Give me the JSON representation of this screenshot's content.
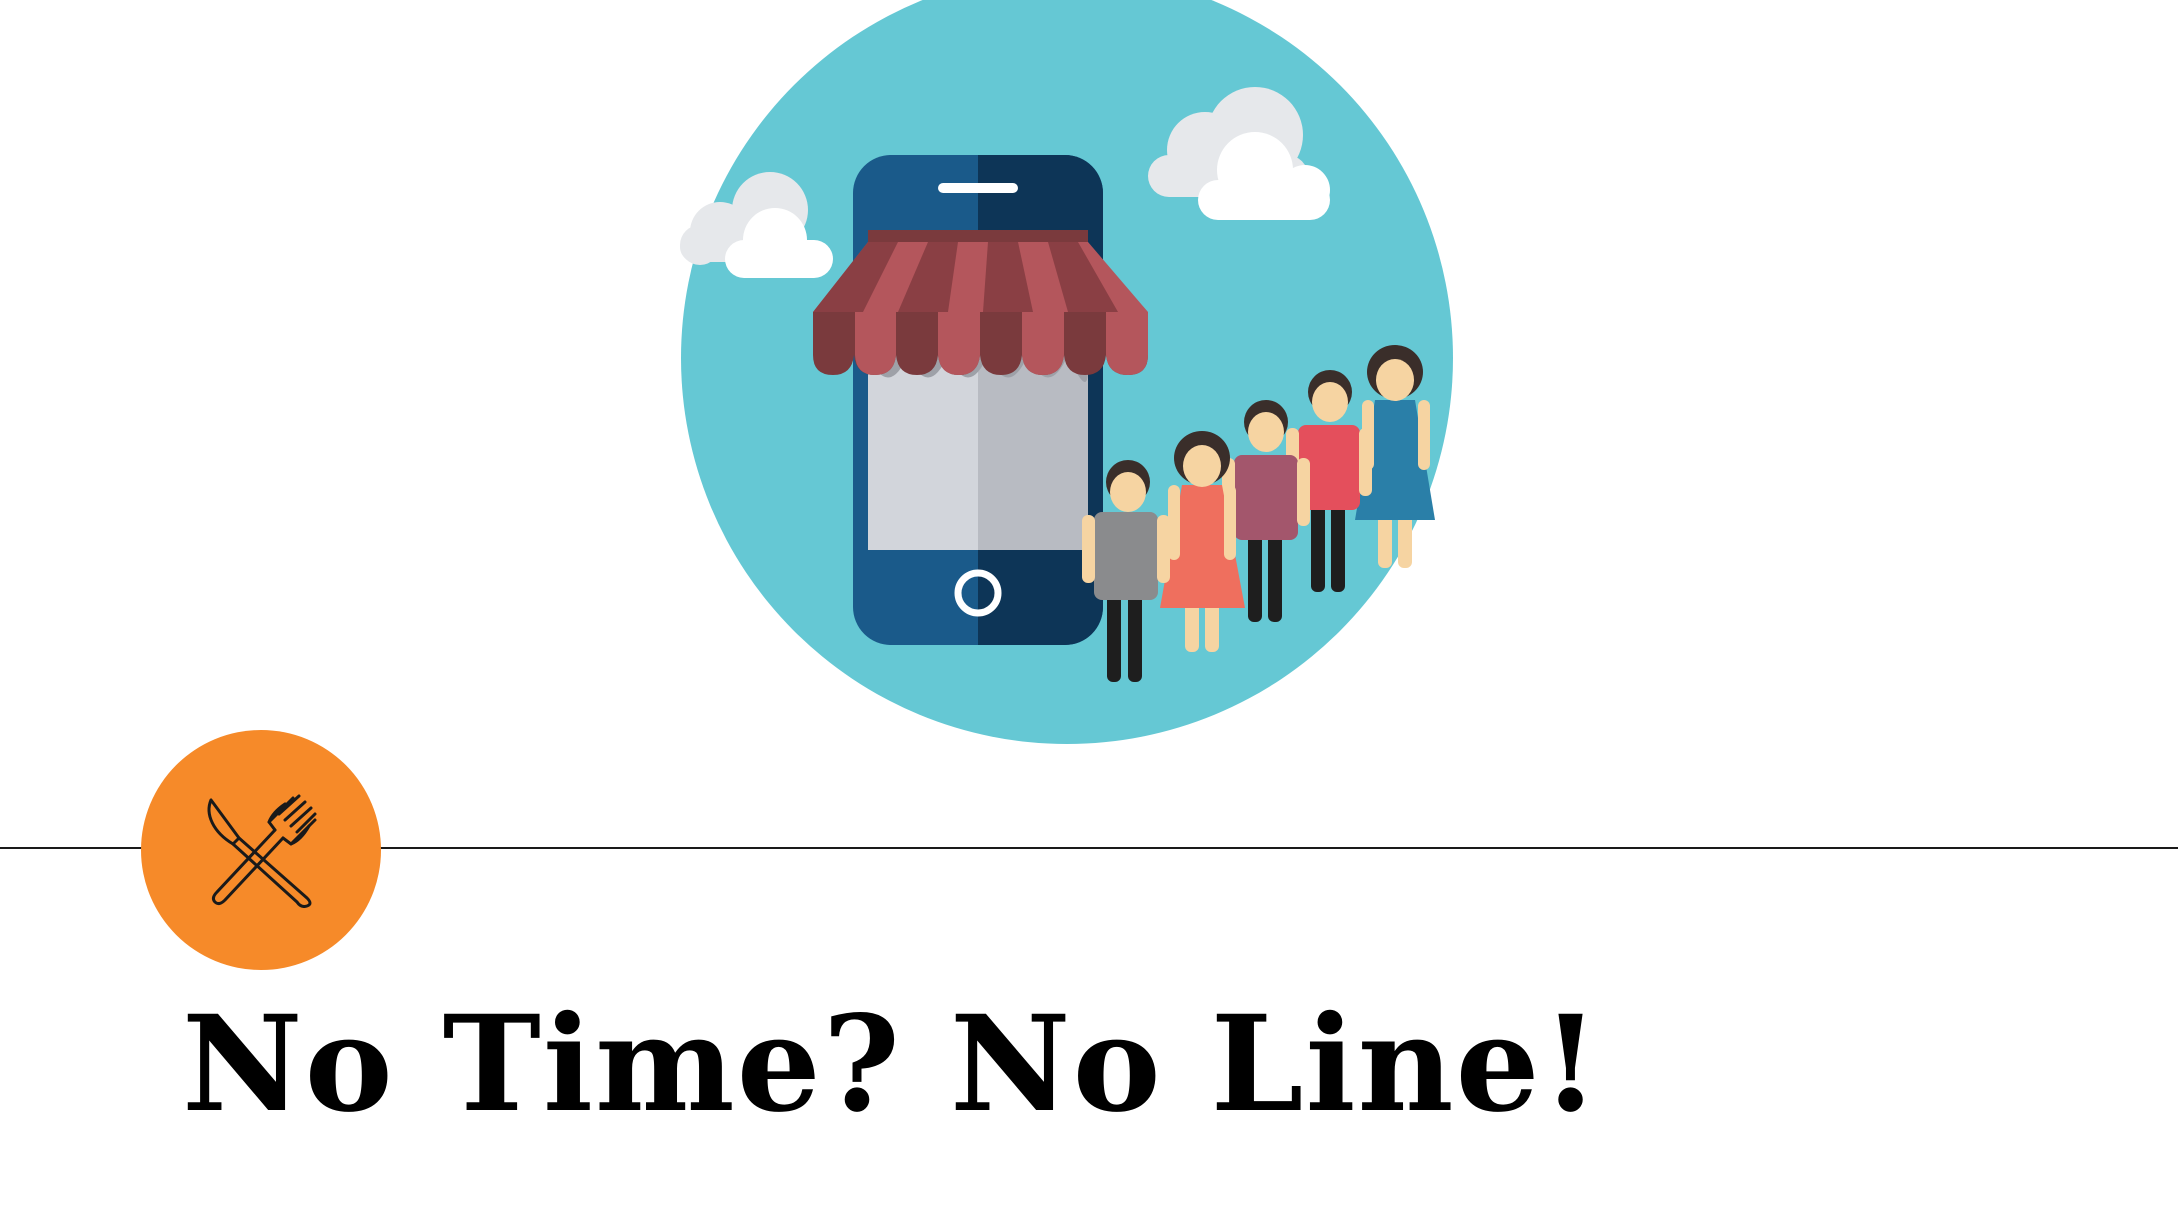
{
  "slide": {
    "title": "No Time? No Line!"
  },
  "illustration": {
    "icon": "mobile-storefront-with-queue-illustration",
    "colors": {
      "circle": "#65c8d4",
      "phone": "#1a5a8a",
      "awning": "#b4565c"
    }
  },
  "badge": {
    "icon": "fork-and-knife-icon",
    "color": "#f68a29"
  }
}
